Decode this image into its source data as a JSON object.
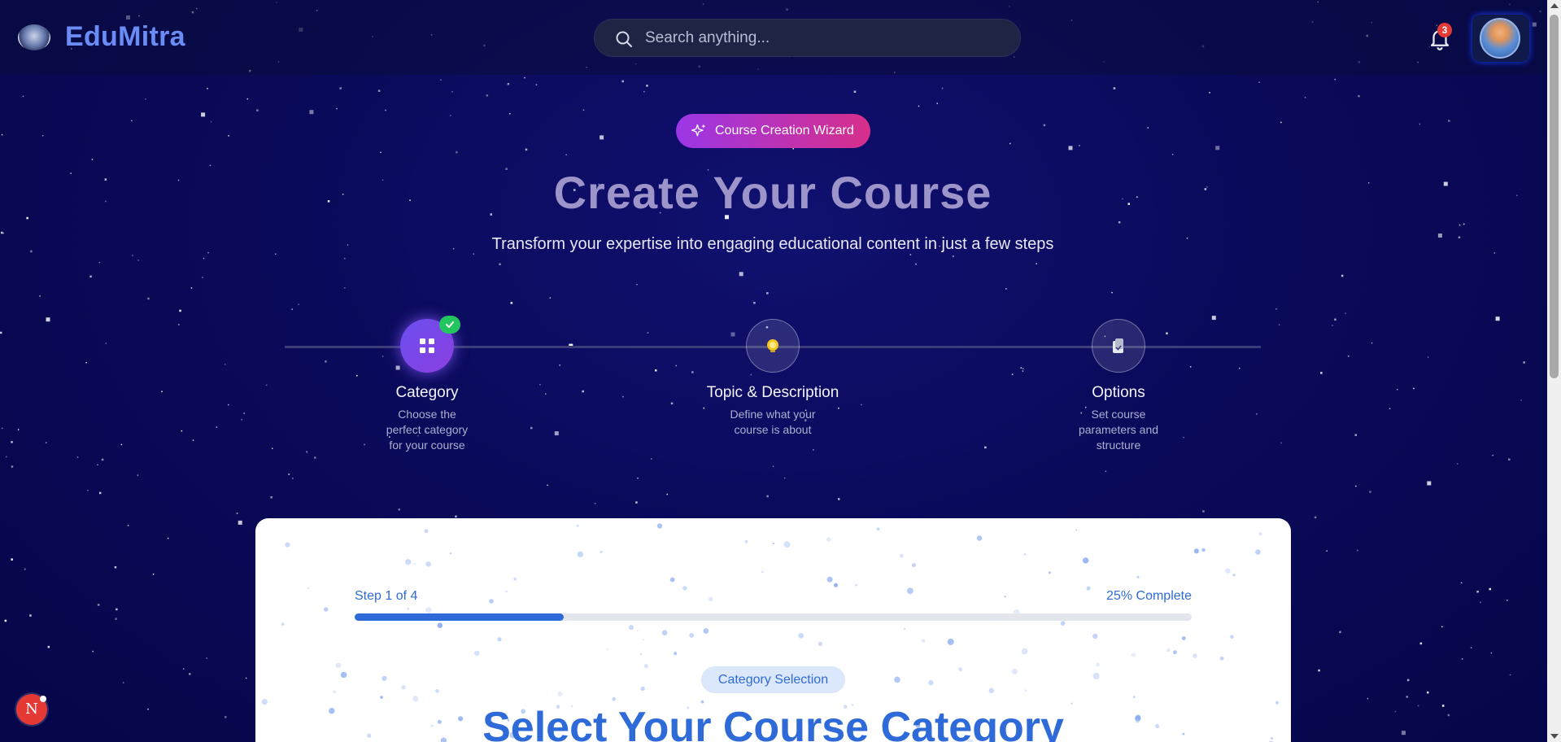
{
  "colors": {
    "accent": "#2f6bd8",
    "brand": "#6b8cf5",
    "wizard_gradient_start": "#9b36e6",
    "wizard_gradient_end": "#d72f8a",
    "success": "#22c55e",
    "alert": "#e53935"
  },
  "header": {
    "logo_icon": "edumitra-logo",
    "brand_name": "EduMitra",
    "search_placeholder": "Search anything...",
    "search_value": "",
    "notifications_count": "3",
    "avatar_icon": "user-avatar"
  },
  "hero": {
    "wizard_label": "Course Creation Wizard",
    "wizard_icon": "sparkles-icon",
    "title": "Create Your Course",
    "subtitle": "Transform your expertise into engaging educational content in just a few steps"
  },
  "steps": [
    {
      "title": "Category",
      "description": "Choose the perfect category for your course",
      "icon": "grid-icon",
      "state": "active-complete"
    },
    {
      "title": "Topic & Description",
      "description": "Define what your course is about",
      "icon": "lightbulb-icon",
      "state": "pending"
    },
    {
      "title": "Options",
      "description": "Set course parameters and structure",
      "icon": "clipboard-icon",
      "state": "pending"
    }
  ],
  "card": {
    "step_text": "Step 1 of 4",
    "complete_text": "25% Complete",
    "progress": 0.25,
    "section_badge": "Category Selection",
    "section_title": "Select Your Course Category"
  },
  "floating": {
    "n_button_label": "N"
  }
}
